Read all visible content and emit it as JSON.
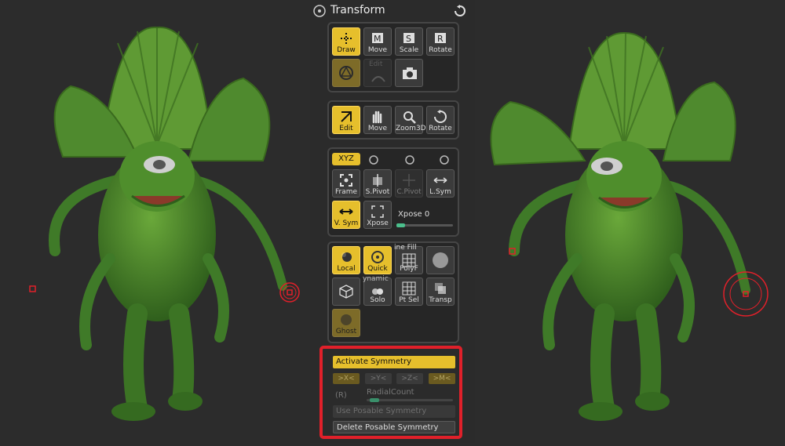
{
  "panel": {
    "title": "Transform",
    "group1": {
      "draw": "Draw",
      "move": "Move",
      "scale": "Scale",
      "rotate": "Rotate",
      "edit_badge": "Edit"
    },
    "group2": {
      "edit": "Edit",
      "move": "Move",
      "zoom3d": "Zoom3D",
      "rotate": "Rotate"
    },
    "group3": {
      "frame": "Frame",
      "spivot": "S.Pivot",
      "cpivot": "C.Pivot",
      "lsym": "L.Sym",
      "vsym": "V. Sym",
      "xpose_btn": "Xpose",
      "xpose_label": "Xpose",
      "xpose_value": "0",
      "xpose_level": 0.15
    },
    "group4": {
      "local": "Local",
      "quick": "Quick",
      "polyf": "PolyF",
      "line_fill": "ine Fill",
      "solo": "Solo",
      "dynamic": "ynamic",
      "ptsel": "Pt Sel",
      "transp": "Transp",
      "ghost": "Ghost"
    },
    "symmetry": {
      "activate": "Activate Symmetry",
      "axis_x": ">X<",
      "axis_y": ">Y<",
      "axis_z": ">Z<",
      "axis_m": ">M<",
      "radial_r": "(R)",
      "radial_label": "RadialCount",
      "use_posable": "Use Posable Symmetry",
      "delete_posable": "Delete Posable Symmetry"
    }
  },
  "colors": {
    "active": "#e6bf2c",
    "highlight_frame": "#e0202a",
    "slider": "#4bbf8c",
    "model_green": "#4a8a2a"
  }
}
